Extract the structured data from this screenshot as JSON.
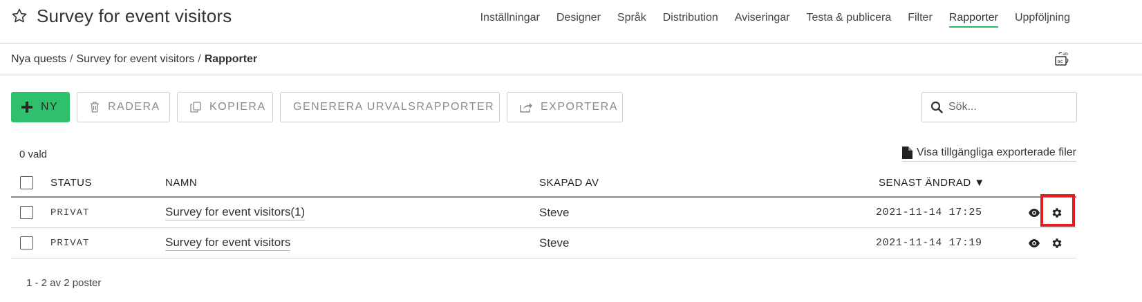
{
  "header": {
    "title": "Survey for event visitors",
    "nav": [
      {
        "label": "Inställningar",
        "active": false
      },
      {
        "label": "Designer",
        "active": false
      },
      {
        "label": "Språk",
        "active": false
      },
      {
        "label": "Distribution",
        "active": false
      },
      {
        "label": "Aviseringar",
        "active": false
      },
      {
        "label": "Testa & publicera",
        "active": false
      },
      {
        "label": "Filter",
        "active": false
      },
      {
        "label": "Rapporter",
        "active": true
      },
      {
        "label": "Uppföljning",
        "active": false
      }
    ]
  },
  "breadcrumb": {
    "items": [
      "Nya quests",
      "Survey for event visitors",
      "Rapporter"
    ],
    "separator": "/"
  },
  "toolbar": {
    "new_label": "NY",
    "delete_label": "RADERA",
    "copy_label": "KOPIERA",
    "generate_label": "GENERERA URVALSRAPPORTER",
    "export_label": "EXPORTERA"
  },
  "search": {
    "placeholder": "Sök..."
  },
  "list": {
    "selected_count": "0 vald",
    "export_files_label": "Visa tillgängliga exporterade filer",
    "columns": {
      "status": "STATUS",
      "name": "NAMN",
      "created_by": "SKAPAD AV",
      "last_modified": "SENAST ÄNDRAD ▼"
    },
    "rows": [
      {
        "status": "PRIVAT",
        "name": "Survey for event visitors(1)",
        "created_by": "Steve",
        "modified": "2021-11-14 17:25"
      },
      {
        "status": "PRIVAT",
        "name": "Survey for event visitors",
        "created_by": "Steve",
        "modified": "2021-11-14 17:19"
      }
    ],
    "pagination": "1 - 2 av 2 poster"
  },
  "colors": {
    "accent": "#2fc06e",
    "highlight": "#e31d1d"
  },
  "icons": {
    "favorite": "star-icon",
    "translate": "translate-icon",
    "new": "plus-icon",
    "delete": "trash-icon",
    "copy": "copy-icon",
    "export": "share-icon",
    "search": "search-icon",
    "file": "file-icon",
    "view": "eye-icon",
    "settings": "gear-icon"
  }
}
